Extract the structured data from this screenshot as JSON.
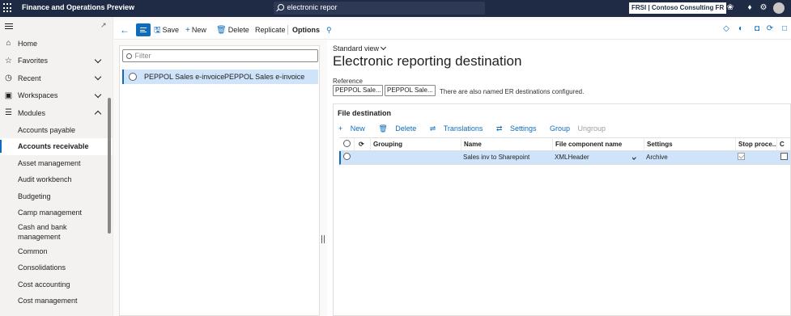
{
  "topbar": {
    "app_title": "Finance and Operations Preview",
    "search_value": "electronic repor",
    "company": "FRSI | Contoso Consulting FR",
    "icons": [
      "copilot-icon",
      "settings-icon",
      "bell-icon",
      "gear-icon",
      "help-icon"
    ]
  },
  "nav": {
    "items": [
      {
        "label": "Home",
        "icon": "home-icon"
      },
      {
        "label": "Favorites",
        "icon": "star-icon"
      },
      {
        "label": "Recent",
        "icon": "clock-icon"
      },
      {
        "label": "Workspaces",
        "icon": "workspace-icon"
      },
      {
        "label": "Modules",
        "icon": "list-icon"
      }
    ],
    "modules": [
      "Accounts payable",
      "Accounts receivable",
      "Asset management",
      "Audit workbench",
      "Budgeting",
      "Camp management",
      "Cash and bank management",
      "Common",
      "Consolidations",
      "Cost accounting",
      "Cost management"
    ],
    "active_module": "Accounts receivable"
  },
  "actions": {
    "save": "Save",
    "new": "New",
    "delete": "Delete",
    "replicate": "Replicate",
    "options": "Options"
  },
  "list": {
    "filter_placeholder": "Filter",
    "rows": [
      {
        "col1": "PEPPOL Sales e-invoice",
        "col2": "PEPPOL Sales e-invoice"
      }
    ]
  },
  "details": {
    "view": "Standard view",
    "title": "Electronic reporting destination",
    "reference_label": "Reference",
    "reference_values": [
      "PEPPOL Sale...",
      "PEPPOL Sale..."
    ],
    "reference_note": "There are also named ER destinations configured.",
    "file_destination": {
      "header": "File destination",
      "toolbar": {
        "new": "New",
        "delete": "Delete",
        "translations": "Translations",
        "settings": "Settings",
        "group": "Group",
        "ungroup": "Ungroup"
      },
      "columns": [
        "Grouping",
        "Name",
        "File component name",
        "Settings",
        "Stop proce...",
        "C"
      ],
      "rows": [
        {
          "grouping": "",
          "name": "Sales inv to Sharepoint",
          "file_component": "XMLHeader",
          "settings": "Archive",
          "stop_processing": true,
          "c": false
        }
      ]
    }
  },
  "colors": {
    "accent": "#0f6cbd",
    "topbar": "#1f2a44",
    "selected_row": "#cfe4fa"
  }
}
